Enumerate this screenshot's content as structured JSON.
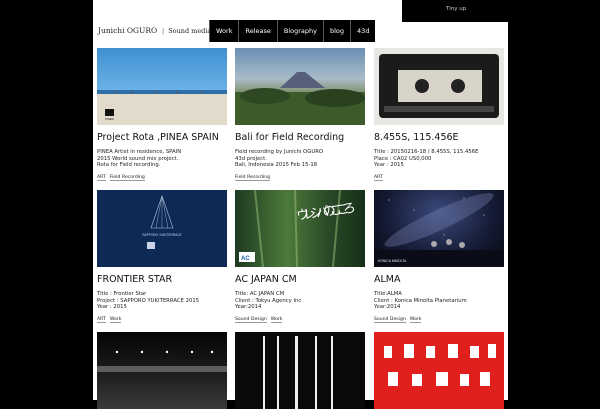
{
  "header": {
    "site_name": "Junichi OGURO",
    "tagline": "Sound media artist, Composer, Creative director.",
    "top_link": "Tiny up"
  },
  "nav": [
    "Work",
    "Release",
    "Biography",
    "blog",
    "43d"
  ],
  "cards": [
    {
      "title": "Project Rota ,PINEA SPAIN",
      "lines": [
        "PINEA Artist in residence, SPAIN",
        "2015 World sound mix project.",
        "Rota for Field recording."
      ],
      "tags": [
        "ART",
        "Field Recording"
      ]
    },
    {
      "title": "Bali for Field Recording",
      "lines": [
        "Field recording by Junichi OGURO",
        "43d project.",
        "Bali, Indonesia 2015 Feb 15-18"
      ],
      "tags": [
        "Field Recording"
      ]
    },
    {
      "title": "8.455S, 115.456E",
      "lines": [
        "Title : 20150216-18 / 8.455S, 115.456E",
        "Place : CA02 US0,000",
        "Year : 2015"
      ],
      "tags": [
        "ART"
      ]
    },
    {
      "title": "FRONTIER STAR",
      "lines": [
        "Title : Frontier Star",
        "Project : SAPPORO YUKITERRACE 2015",
        "Year : 2015"
      ],
      "tags": [
        "ART",
        "Work"
      ]
    },
    {
      "title": "AC JAPAN CM",
      "lines": [
        "Title: AC JAPAN CM",
        "Client : Tokyu Agency Inc",
        "Year:2014"
      ],
      "tags": [
        "Sound Design",
        "Work"
      ]
    },
    {
      "title": "ALMA",
      "lines": [
        "Title:ALMA",
        "Client : Konica Minolta Planetarium",
        "Year:2014"
      ],
      "tags": [
        "Sound Design",
        "Work"
      ]
    }
  ],
  "image_text": {
    "pinea_logo": "PINEA",
    "frontier_logo": "SAPPORO YUKITERRACE",
    "ac_logo": "AC",
    "ac_calligraphy": "ウレシパのこころ",
    "alma_logo": "KONICA MINOLTA"
  },
  "colors": {
    "accent_red": "#e01f1f",
    "nav_bg": "#000000"
  }
}
